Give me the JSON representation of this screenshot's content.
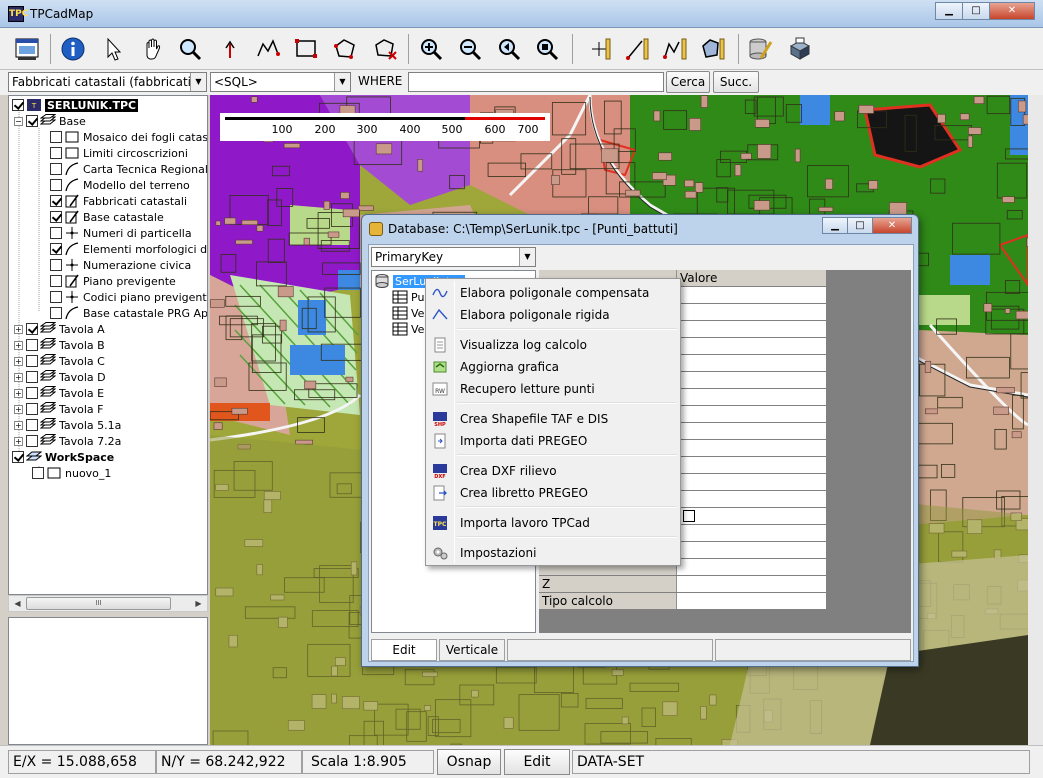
{
  "window": {
    "title": "TPCadMap",
    "app_icon_text": "TPC"
  },
  "searchbar": {
    "layer_select": "Fabbricati catastali (fabbricati)",
    "sql_select": "<SQL>",
    "where_label": "WHERE",
    "where_value": "",
    "search_button": "Cerca",
    "next_button": "Succ."
  },
  "tree": {
    "root": "SERLUNIK.TPC",
    "base": "Base",
    "items": [
      "Mosaico dei fogli catastal",
      "Limiti circoscrizioni",
      "Carta Tecnica Regionale",
      "Modello del terreno",
      "Fabbricati catastali",
      "Base catastale",
      "Numeri di particella",
      "Elementi morfologici del te",
      "Numerazione civica",
      "Piano previgente",
      "Codici piano previgente",
      "Base catastale PRG Appr"
    ],
    "groups": [
      "Tavola A",
      "Tavola B",
      "Tavola C",
      "Tavola D",
      "Tavola E",
      "Tavola F",
      "Tavola 5.1a",
      "Tavola 7.2a"
    ],
    "workspace": "WorkSpace",
    "workspace_child": "nuovo_1",
    "scroll_grip": "III"
  },
  "scalebar": {
    "labels": [
      "100",
      "200",
      "300",
      "400",
      "500",
      "600",
      "700"
    ]
  },
  "dialog": {
    "title": "Database: C:\\Temp\\SerLunik.tpc - [Punti_battuti]",
    "key_select": "PrimaryKey",
    "tree_root": "SerLunik.tpc",
    "tree_children": [
      "Pun",
      "Ve",
      "Ve"
    ],
    "column_value": "Valore",
    "row_z": "Z",
    "row_tipo": "Tipo calcolo",
    "tabs": [
      "Edit",
      "Verticale"
    ]
  },
  "context_menu": {
    "items": [
      {
        "label": "Elabora poligonale compensata",
        "icon": "curve-icon"
      },
      {
        "label": "Elabora poligonale rigida",
        "icon": "polyline-icon"
      },
      {
        "label": "Visualizza log calcolo",
        "icon": "log-icon"
      },
      {
        "label": "Aggiorna grafica",
        "icon": "refresh-graphics-icon"
      },
      {
        "label": "Recupero letture punti",
        "icon": "points-read-icon"
      },
      {
        "label": "Crea Shapefile TAF e DIS",
        "icon": "shapefile-icon"
      },
      {
        "label": "Importa dati PREGEO",
        "icon": "import-icon"
      },
      {
        "label": "Crea DXF rilievo",
        "icon": "dxf-icon"
      },
      {
        "label": "Crea libretto PREGEO",
        "icon": "export-icon"
      },
      {
        "label": "Importa lavoro TPCad",
        "icon": "tpcad-icon"
      },
      {
        "label": "Impostazioni",
        "icon": "gears-icon"
      }
    ]
  },
  "statusbar": {
    "ex": "E/X = 15.088,658",
    "ny": "N/Y = 68.242,922",
    "scale": "Scala 1:8.905",
    "osnap": "Osnap",
    "edit": "Edit",
    "dataset": "DATA-SET"
  },
  "colors": {
    "map_green": "#3c8f20",
    "map_purple": "#8f19c8",
    "map_olive": "#a9b43a",
    "map_salmon": "#e7b3a0",
    "menu_highlight": "#3399ff"
  }
}
